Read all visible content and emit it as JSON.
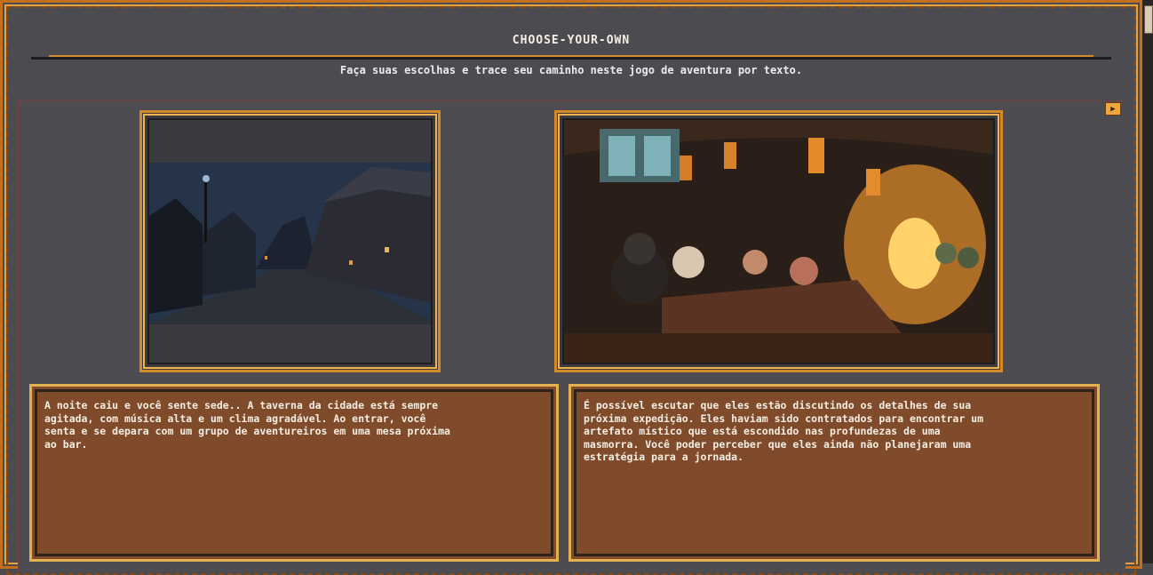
{
  "title": "CHOOSE-YOUR-OWN",
  "subtitle": "Faça suas escolhas e trace seu caminho neste jogo de aventura por texto.",
  "colors": {
    "frame": "#c46f1c",
    "accent": "#f0a73e",
    "text_box": "#7f4b2a",
    "background": "#4c4b50"
  },
  "images": [
    {
      "name": "night-street-image",
      "icon": "village-street-night"
    },
    {
      "name": "tavern-image",
      "icon": "tavern-interior-adventurers"
    }
  ],
  "scenes": {
    "left_text": "A noite caiu e você sente sede.. A taverna da cidade está sempre\nagitada, com música alta e um clima agradável. Ao entrar, você\nsenta e se depara com um grupo de aventureiros em uma mesa próxima\nao bar.",
    "right_text": "É possível escutar que eles estão discutindo os detalhes de sua\npróxima expedição. Eles haviam sido contratados para encontrar um\nartefato místico que está escondido nas profundezas de uma\nmasmorra. Você poder perceber que eles ainda não planejaram uma\nestratégia para a jornada."
  },
  "controls": {
    "play_icon": "▶"
  }
}
